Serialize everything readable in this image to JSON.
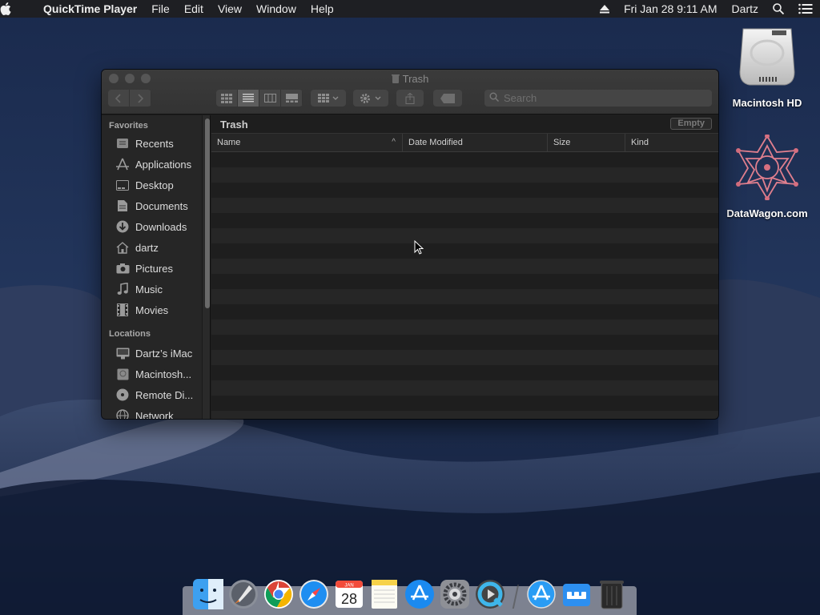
{
  "menubar": {
    "app_name": "QuickTime Player",
    "menus": [
      "File",
      "Edit",
      "View",
      "Window",
      "Help"
    ],
    "clock": "Fri Jan 28  9:11 AM",
    "user": "Dartz",
    "icons": [
      "apple-icon",
      "eject-icon",
      "spotlight-icon",
      "notification-center-icon"
    ]
  },
  "desktop": {
    "icons": [
      {
        "label": "Macintosh HD",
        "icon": "hard-drive-icon"
      },
      {
        "label": "DataWagon.com",
        "icon": "datawagon-logo-icon"
      }
    ]
  },
  "window": {
    "title": "Trash",
    "search_placeholder": "Search",
    "path_title": "Trash",
    "empty_label": "Empty",
    "sidebar": {
      "favorites_heading": "Favorites",
      "favorites": [
        {
          "label": "Recents",
          "icon": "recents-icon"
        },
        {
          "label": "Applications",
          "icon": "applications-icon"
        },
        {
          "label": "Desktop",
          "icon": "desktop-icon"
        },
        {
          "label": "Documents",
          "icon": "documents-icon"
        },
        {
          "label": "Downloads",
          "icon": "downloads-icon"
        },
        {
          "label": "dartz",
          "icon": "home-icon"
        },
        {
          "label": "Pictures",
          "icon": "pictures-icon"
        },
        {
          "label": "Music",
          "icon": "music-icon"
        },
        {
          "label": "Movies",
          "icon": "movies-icon"
        }
      ],
      "locations_heading": "Locations",
      "locations": [
        {
          "label": "Dartz’s iMac",
          "icon": "imac-icon"
        },
        {
          "label": "Macintosh...",
          "icon": "disk-icon"
        },
        {
          "label": "Remote Di...",
          "icon": "remote-disc-icon"
        },
        {
          "label": "Network",
          "icon": "network-icon"
        }
      ]
    },
    "columns": [
      {
        "label": "Name"
      },
      {
        "label": "Date Modified"
      },
      {
        "label": "Size"
      },
      {
        "label": "Kind"
      }
    ]
  },
  "dock": {
    "apps": [
      "finder-icon",
      "launchpad-icon",
      "chrome-icon",
      "safari-icon",
      "calendar-icon",
      "notes-icon",
      "app-store-icon",
      "system-preferences-icon",
      "quicktime-icon"
    ],
    "calendar_month": "JAN",
    "calendar_day": "28",
    "extras": [
      "applications-folder-icon",
      "downloads-stack-icon",
      "trash-icon"
    ]
  }
}
